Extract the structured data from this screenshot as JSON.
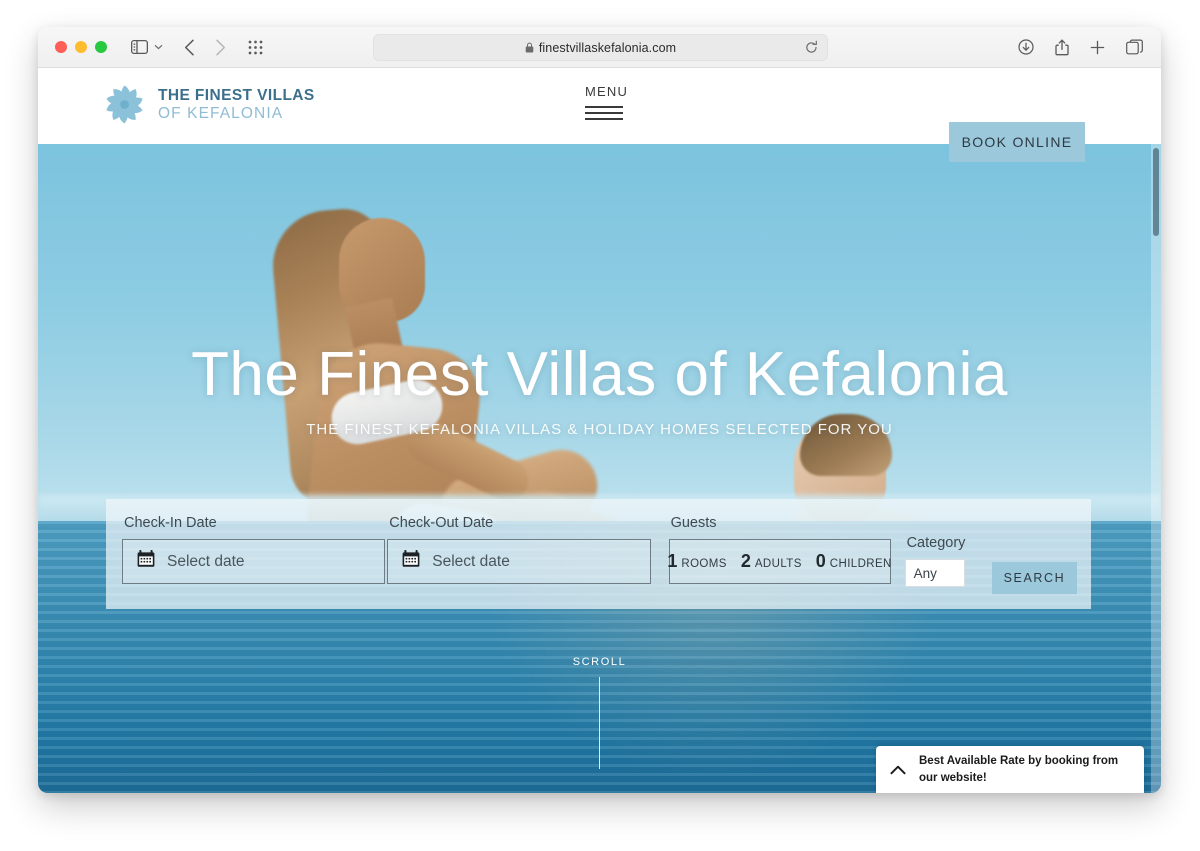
{
  "browser": {
    "url": "finestvillaskefalonia.com",
    "lock_icon": "lock-icon",
    "reload_icon": "reload-icon",
    "sidebar_icon": "sidebar-icon",
    "back_icon": "chevron-left-icon",
    "forward_icon": "chevron-right-icon",
    "grid_icon": "app-grid-icon",
    "download_icon": "download-icon",
    "share_icon": "share-icon",
    "new_tab_icon": "plus-icon",
    "tabs_icon": "tab-overview-icon",
    "traffic_lights": [
      "close",
      "minimize",
      "zoom"
    ]
  },
  "site_header": {
    "logo": {
      "mark": "sunburst-pinwheel-icon",
      "line1": "THE FINEST VILLAS",
      "line2": "OF KEFALONIA"
    },
    "menu_label": "MENU",
    "menu_icon": "hamburger-icon",
    "book_online_label": "BOOK ONLINE"
  },
  "hero": {
    "title": "The Finest Villas of Kefalonia",
    "subtitle": "THE FINEST KEFALONIA VILLAS & HOLIDAY HOMES SELECTED FOR YOU",
    "scroll_label": "SCROLL"
  },
  "booking": {
    "checkin": {
      "label": "Check-In Date",
      "placeholder": "Select date",
      "icon": "calendar-icon"
    },
    "checkout": {
      "label": "Check-Out Date",
      "placeholder": "Select date",
      "icon": "calendar-icon"
    },
    "guests": {
      "label": "Guests",
      "segments": [
        {
          "value": "1",
          "caption": "ROOMS"
        },
        {
          "value": "2",
          "caption": "ADULTS"
        },
        {
          "value": "0",
          "caption": "CHILDREN"
        }
      ]
    },
    "category": {
      "label": "Category",
      "value": "Any"
    },
    "search_label": "SEARCH"
  },
  "notification": {
    "chevron_icon": "chevron-up-icon",
    "text": "Best Available Rate by booking from our website!"
  },
  "colors": {
    "brand_blue": "#9cc8dc",
    "logo_dark": "#3c6f8c",
    "logo_light": "#8fbcd4",
    "water": "#2f86b0",
    "sky": "#8fcde3"
  }
}
